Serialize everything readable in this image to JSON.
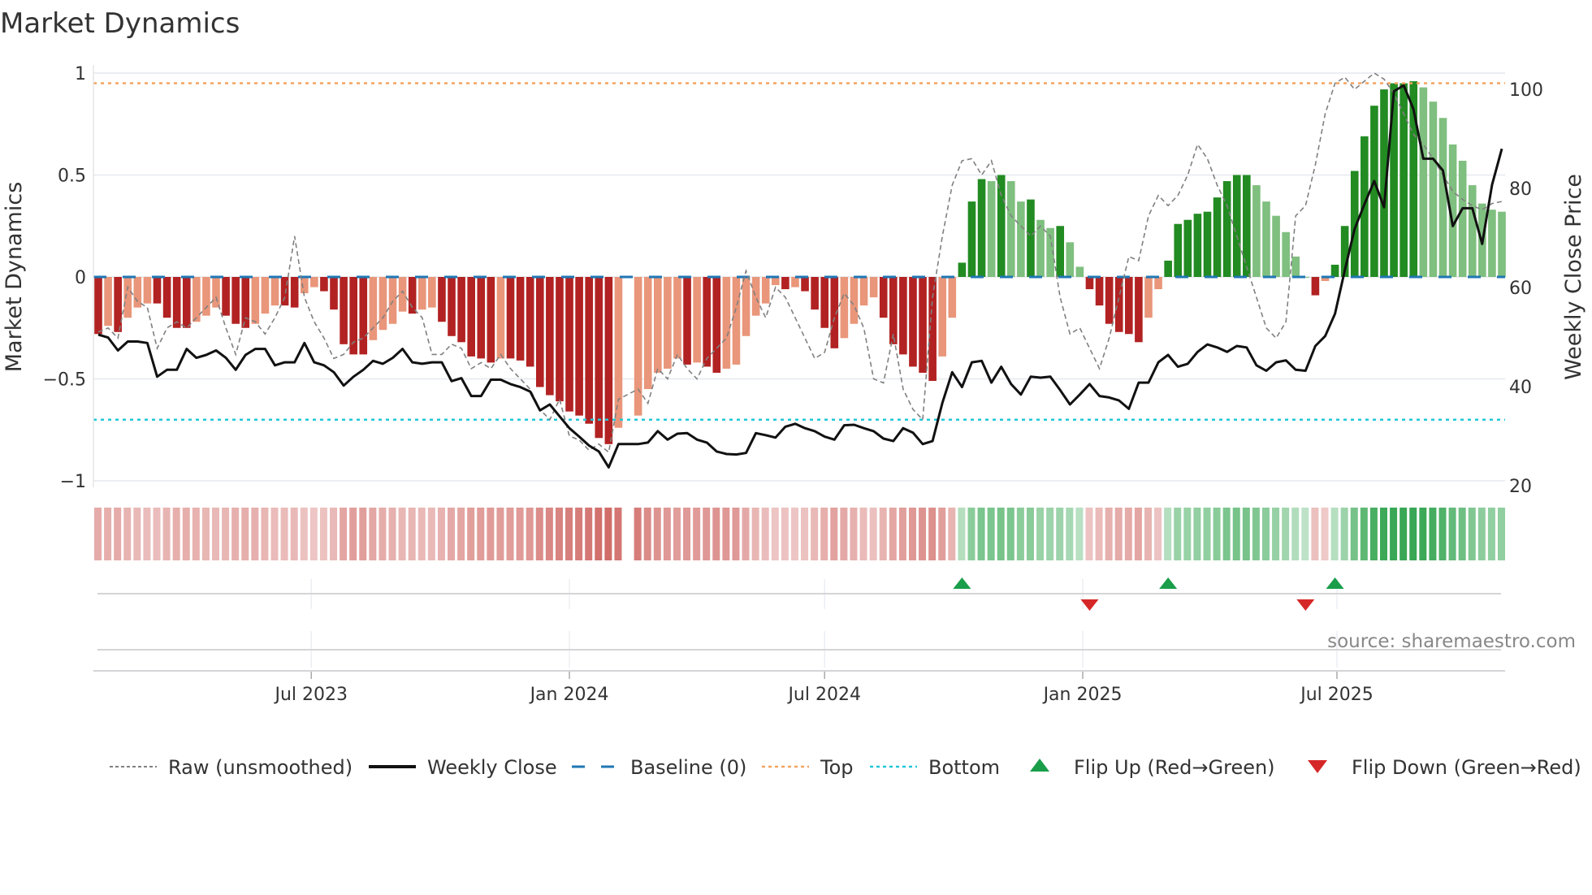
{
  "chart_data": {
    "type": "bar",
    "title": "Market Dynamics",
    "ylabel": "Market Dynamics",
    "y2label": "Weekly Close Price",
    "ylim": [
      -1,
      1
    ],
    "y2lim": [
      20,
      100
    ],
    "y_ticks": [
      {
        "v": 1,
        "label": "1"
      },
      {
        "v": 0.5,
        "label": "0.5"
      },
      {
        "v": 0,
        "label": "0"
      },
      {
        "v": -0.5,
        "label": "−0.5"
      },
      {
        "v": -1,
        "label": "−1"
      }
    ],
    "y2_ticks": [
      {
        "v": 100,
        "label": "100"
      },
      {
        "v": 80,
        "label": "80"
      },
      {
        "v": 60,
        "label": "60"
      },
      {
        "v": 40,
        "label": "40"
      },
      {
        "v": 20,
        "label": "20"
      }
    ],
    "x_ticks": [
      {
        "week": 21.7,
        "label": "Jul 2023"
      },
      {
        "week": 48.0,
        "label": "Jan 2024"
      },
      {
        "week": 74.0,
        "label": "Jul 2024"
      },
      {
        "week": 100.3,
        "label": "Jan 2025"
      },
      {
        "week": 126.2,
        "label": "Jul 2025"
      }
    ],
    "baseline": 0,
    "top": 0.95,
    "bottom": -0.7,
    "grid": true,
    "momentum": [
      -0.28,
      -0.24,
      -0.27,
      -0.2,
      -0.15,
      -0.13,
      -0.13,
      -0.2,
      -0.25,
      -0.25,
      -0.22,
      -0.19,
      -0.15,
      -0.19,
      -0.23,
      -0.25,
      -0.23,
      -0.18,
      -0.14,
      -0.14,
      -0.15,
      -0.08,
      -0.05,
      -0.07,
      -0.16,
      -0.33,
      -0.38,
      -0.38,
      -0.31,
      -0.26,
      -0.23,
      -0.17,
      -0.18,
      -0.16,
      -0.15,
      -0.22,
      -0.29,
      -0.32,
      -0.39,
      -0.4,
      -0.42,
      -0.4,
      -0.4,
      -0.41,
      -0.44,
      -0.54,
      -0.58,
      -0.61,
      -0.66,
      -0.68,
      -0.72,
      -0.79,
      -0.82,
      -0.74,
      null,
      -0.68,
      -0.55,
      -0.47,
      -0.45,
      -0.4,
      -0.43,
      -0.42,
      -0.44,
      -0.47,
      -0.45,
      -0.43,
      -0.29,
      -0.19,
      -0.13,
      -0.04,
      -0.06,
      -0.05,
      -0.07,
      -0.16,
      -0.25,
      -0.35,
      -0.3,
      -0.23,
      -0.14,
      -0.1,
      -0.2,
      -0.33,
      -0.38,
      -0.44,
      -0.47,
      -0.51,
      -0.39,
      -0.2,
      0.07,
      0.37,
      0.48,
      0.47,
      0.5,
      0.47,
      0.37,
      0.38,
      0.28,
      0.24,
      0.25,
      0.17,
      0.05,
      -0.06,
      -0.14,
      -0.23,
      -0.27,
      -0.28,
      -0.32,
      -0.2,
      -0.06,
      0.08,
      0.26,
      0.28,
      0.31,
      0.32,
      0.39,
      0.47,
      0.5,
      0.5,
      0.45,
      0.37,
      0.3,
      0.22,
      0.1,
      0.0,
      -0.09,
      -0.02,
      0.06,
      0.25,
      0.52,
      0.69,
      0.84,
      0.92,
      0.95,
      0.95,
      0.96,
      0.93,
      0.86,
      0.78,
      0.65,
      0.57,
      0.45,
      0.36,
      0.33,
      0.32
    ],
    "raw": [
      -0.27,
      -0.25,
      -0.3,
      -0.05,
      -0.12,
      -0.15,
      -0.35,
      -0.25,
      -0.22,
      -0.25,
      -0.2,
      -0.15,
      -0.1,
      -0.25,
      -0.38,
      -0.2,
      -0.22,
      -0.28,
      -0.2,
      -0.1,
      0.2,
      -0.1,
      -0.22,
      -0.3,
      -0.4,
      -0.38,
      -0.32,
      -0.3,
      -0.25,
      -0.2,
      -0.12,
      -0.07,
      -0.15,
      -0.2,
      -0.38,
      -0.38,
      -0.33,
      -0.35,
      -0.45,
      -0.42,
      -0.45,
      -0.38,
      -0.45,
      -0.5,
      -0.55,
      -0.65,
      -0.7,
      -0.6,
      -0.78,
      -0.8,
      -0.85,
      -0.82,
      -0.86,
      -0.6,
      null,
      -0.55,
      -0.62,
      -0.45,
      -0.5,
      -0.38,
      -0.45,
      -0.5,
      -0.4,
      -0.35,
      -0.3,
      -0.15,
      0.03,
      -0.1,
      -0.2,
      -0.05,
      -0.1,
      -0.2,
      -0.3,
      -0.4,
      -0.37,
      -0.2,
      -0.08,
      -0.14,
      -0.25,
      -0.5,
      -0.52,
      -0.28,
      -0.55,
      -0.65,
      -0.7,
      -0.1,
      0.2,
      0.45,
      0.57,
      0.58,
      0.5,
      0.57,
      0.4,
      0.3,
      0.25,
      0.2,
      0.25,
      0.2,
      -0.1,
      -0.28,
      -0.25,
      -0.35,
      -0.45,
      -0.3,
      -0.1,
      0.1,
      0.08,
      0.3,
      0.4,
      0.35,
      0.4,
      0.5,
      0.65,
      0.58,
      0.45,
      0.35,
      0.2,
      0.05,
      -0.1,
      -0.25,
      -0.3,
      -0.22,
      0.3,
      0.35,
      0.55,
      0.8,
      0.95,
      0.98,
      0.92,
      0.96,
      1.0,
      0.97,
      0.9,
      0.8,
      0.7,
      0.65,
      0.58,
      0.5,
      0.42,
      0.38,
      0.35,
      0.33,
      0.36,
      0.37
    ],
    "weekly_close": [
      50.5,
      49.9,
      47.3,
      49.1,
      49.1,
      48.8,
      42,
      43.4,
      43.4,
      47.6,
      45.8,
      46.4,
      47.3,
      45.8,
      43.4,
      46.4,
      47.6,
      47.6,
      44.3,
      44.9,
      44.9,
      48.8,
      44.9,
      44.3,
      42.9,
      40.2,
      42,
      43.4,
      45.2,
      44.6,
      45.8,
      47.6,
      44.9,
      44.6,
      44.9,
      44.9,
      41.1,
      41.7,
      38.1,
      38.1,
      41.4,
      41.4,
      40.5,
      39.9,
      39,
      35.2,
      36.4,
      34,
      31.6,
      29.9,
      28.1,
      26.9,
      23.7,
      28.4,
      null,
      28.4,
      28.7,
      31,
      29.3,
      30.5,
      30.6,
      29.3,
      28.7,
      26.9,
      26.4,
      26.3,
      26.6,
      30.6,
      30.2,
      29.7,
      31.9,
      32.5,
      31.6,
      31,
      29.9,
      29.3,
      32.2,
      32.3,
      31.6,
      31,
      29.5,
      29,
      31.6,
      30.7,
      28.4,
      29,
      36.7,
      42.9,
      39.9,
      44.9,
      45.2,
      40.8,
      44,
      40.5,
      38.4,
      42,
      41.8,
      42,
      39.3,
      36.4,
      38.4,
      40.5,
      38.1,
      37.8,
      37.2,
      35.5,
      40.8,
      40.8,
      44.9,
      46.4,
      44,
      44.6,
      47,
      48.5,
      47.9,
      47,
      48.2,
      47.9,
      44.3,
      43.2,
      44.9,
      45.3,
      43.4,
      43.2,
      48.2,
      50.2,
      54.7,
      63.5,
      71.8,
      76.8,
      81.5,
      76.2,
      99.6,
      100.8,
      96,
      86,
      86,
      83.6,
      72.4,
      76,
      76,
      68.8,
      80.7,
      88
    ],
    "flips": [
      {
        "week": 88,
        "dir": "up"
      },
      {
        "week": 101,
        "dir": "down"
      },
      {
        "week": 109,
        "dir": "up"
      },
      {
        "week": 123,
        "dir": "down"
      },
      {
        "week": 126,
        "dir": "up"
      }
    ],
    "legend": {
      "placement": "bottom",
      "items": [
        {
          "key": "raw",
          "label": "Raw (unsmoothed)"
        },
        {
          "key": "close",
          "label": "Weekly Close"
        },
        {
          "key": "baseline",
          "label": "Baseline (0)"
        },
        {
          "key": "top",
          "label": "Top"
        },
        {
          "key": "bottom",
          "label": "Bottom"
        },
        {
          "key": "flipup",
          "label": "Flip Up (Red→Green)"
        },
        {
          "key": "flipdown",
          "label": "Flip Down (Green→Red)"
        }
      ]
    },
    "colors": {
      "red_dark": "#b22222",
      "red_light": "#e9967a",
      "green_dark": "#228b22",
      "green_light": "#7fbf7f",
      "raw": "#808080",
      "close": "#111111",
      "baseline": "#1f77b4",
      "top": "#f4a460",
      "bottom": "#22c7d8",
      "flip_up": "#1a9e4a",
      "flip_down": "#d62728"
    }
  },
  "source": "source: sharemaestro.com"
}
